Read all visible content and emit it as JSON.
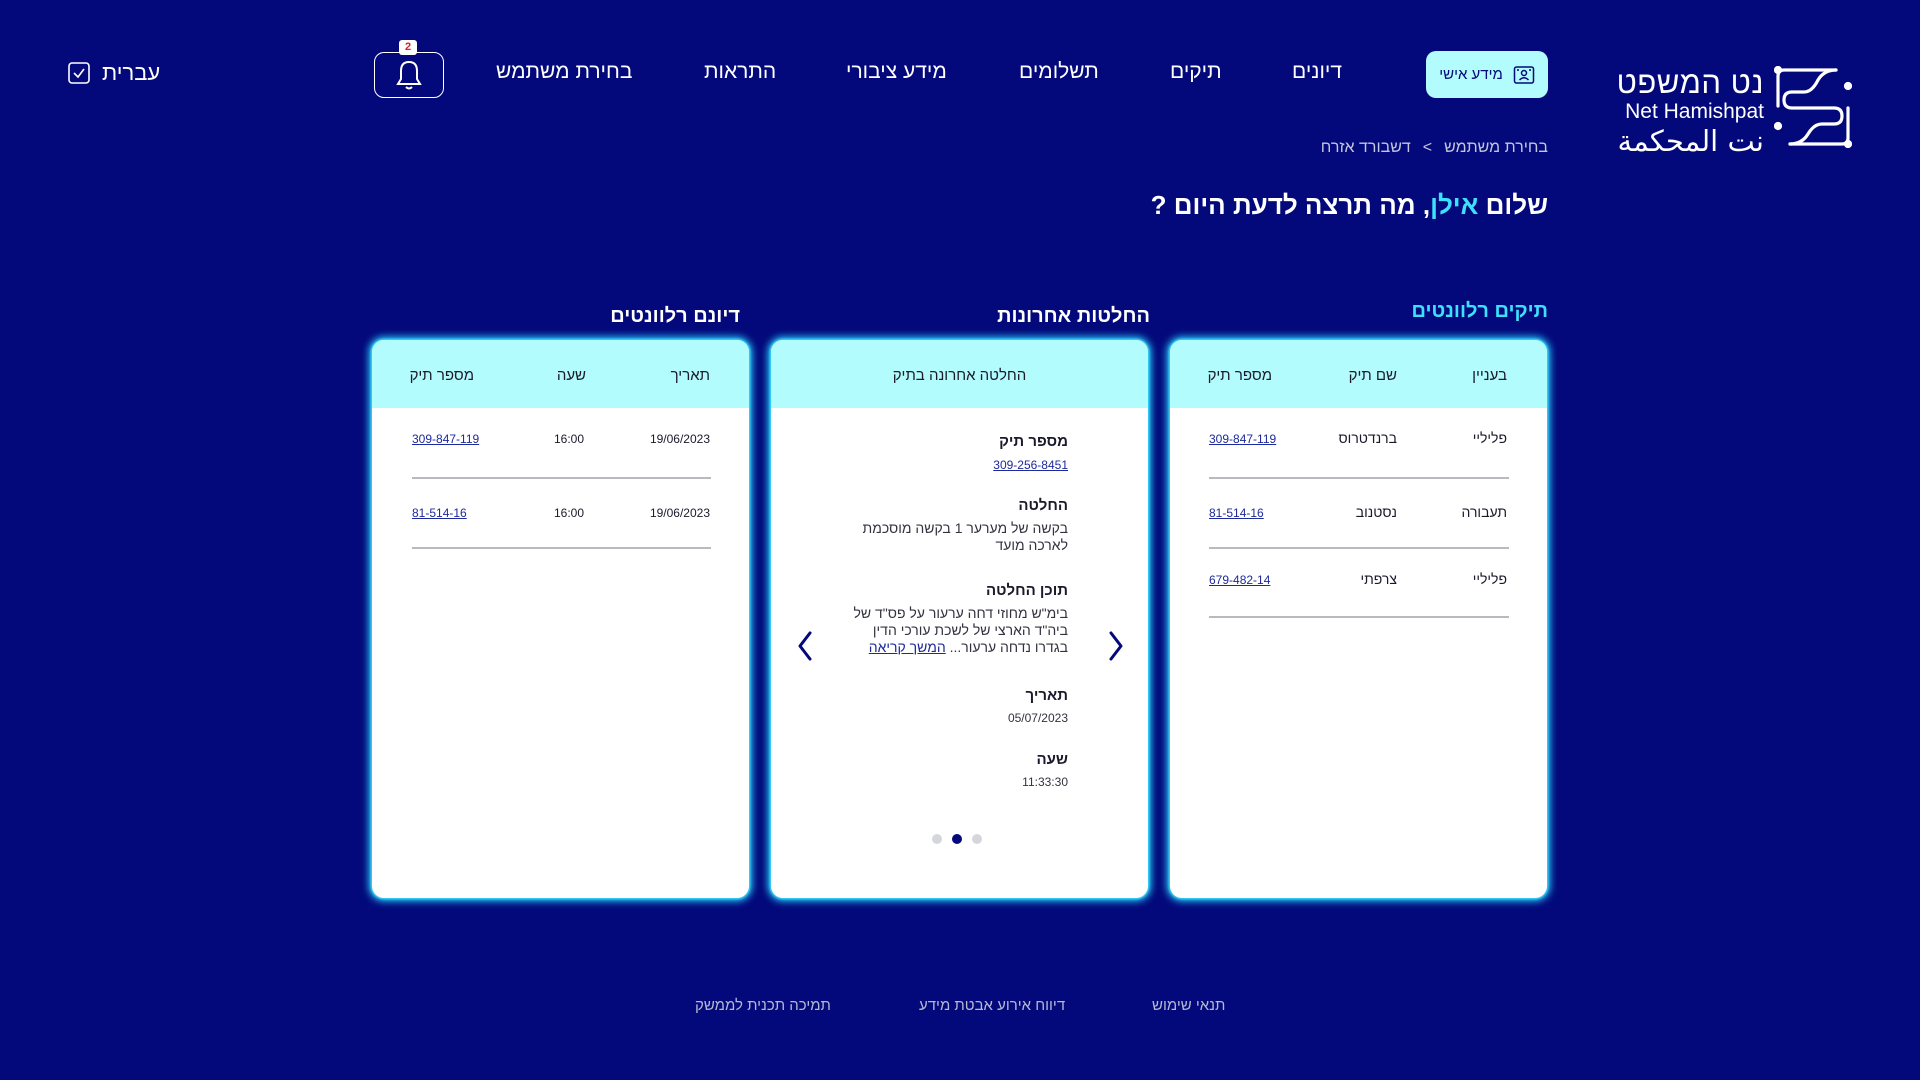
{
  "brand": {
    "name_he": "נט המשפט",
    "name_en": "Net Hamishpat",
    "name_ar": "نت المحكمة",
    "colors": {
      "background": "#03097b",
      "accent": "#b2fcfd",
      "highlight": "#3de1ff",
      "card": "#ffffff"
    }
  },
  "header": {
    "personal_button": {
      "label": "מידע אישי",
      "icon": "personal-info-icon"
    },
    "nav": [
      "דיונים",
      "תיקים",
      "תשלומים",
      "מידע ציבורי",
      "התראות",
      "בחירת משתמש"
    ],
    "notifications": {
      "count": "2",
      "icon": "bell-icon"
    },
    "language": {
      "label": "עברית",
      "icon": "language-icon"
    }
  },
  "breadcrumb": {
    "items": [
      "בחירת משתמש",
      "דשבורד אזרח"
    ],
    "separator": ">"
  },
  "greeting": {
    "hello": "שלום",
    "name": "אילן",
    "rest": ", מה תרצה לדעת היום ?"
  },
  "cases": {
    "title": "תיקים רלוונטים",
    "columns": [
      "בעניין",
      "שם תיק",
      "מספר תיק"
    ],
    "rows": [
      {
        "matter": "פליליי",
        "name": "ברנדטרוס",
        "number": "309-847-119"
      },
      {
        "matter": "תעבורה",
        "name": "נסטנוב",
        "number": "81-514-16"
      },
      {
        "matter": "פליליי",
        "name": "צרפתי",
        "number": "679-482-14"
      }
    ]
  },
  "decisions": {
    "title": "החלטות אחרונות",
    "header": "החלטה אחרונה בתיק",
    "case_number_label": "מספר תיק",
    "case_number": "309-256-8451",
    "decision_label": "החלטה",
    "decision_lines": [
      "בקשה של מערער 1 בקשה מוסכמת",
      "לארכה מועד"
    ],
    "content_label": "תוכן החלטה",
    "content_lines": [
      "בימ\"ש מחוזי דחה ערעור על פס\"ד של",
      "ביה\"ד הארצי של לשכת עורכי הדין",
      "בגדרו נדחה ערעור..."
    ],
    "read_more": "המשך קריאה",
    "date_label": "תאריך",
    "date": "05/07/2023",
    "time_label": "שעה",
    "time": "11:33:30",
    "carousel": {
      "total": 3,
      "active_index": 1
    }
  },
  "hearings": {
    "title": "דיונם רלוונטים",
    "columns": [
      "תאריך",
      "שעה",
      "מספר תיק"
    ],
    "rows": [
      {
        "date": "19/06/2023",
        "time": "16:00",
        "number": "309-847-119"
      },
      {
        "date": "19/06/2023",
        "time": "16:00",
        "number": "81-514-16"
      }
    ]
  },
  "footer": {
    "links": [
      "תנאי שימוש",
      "דיווח אירוע אבטת מידע",
      "תמיכה תכנית לממשק"
    ]
  }
}
